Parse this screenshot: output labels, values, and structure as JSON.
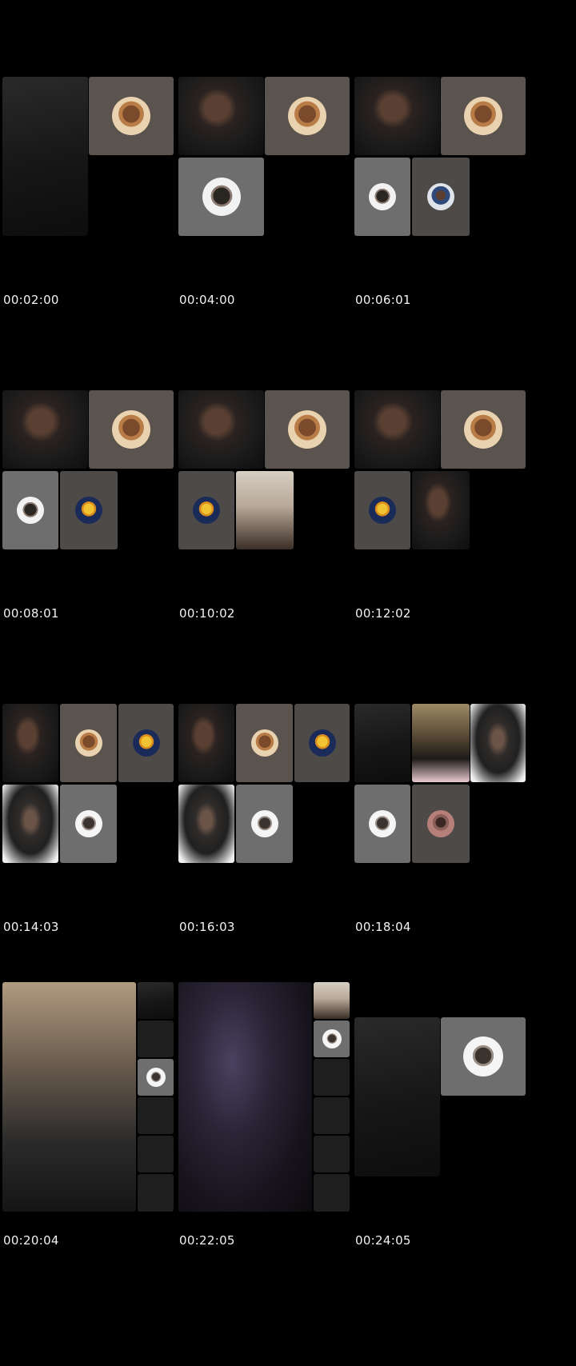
{
  "timestamps": [
    "00:02:00",
    "00:04:00",
    "00:06:01",
    "00:08:01",
    "00:10:02",
    "00:12:02",
    "00:14:03",
    "00:16:03",
    "00:18:04",
    "00:20:04",
    "00:22:05",
    "00:24:05"
  ],
  "colors": {
    "background": "#000000",
    "caption_text": "#f2f2f2",
    "avatar_tile": "#5b534e",
    "avatar_tile_grey": "#6e6e6e"
  },
  "icons": [
    "participant-avatar",
    "participant-video"
  ]
}
